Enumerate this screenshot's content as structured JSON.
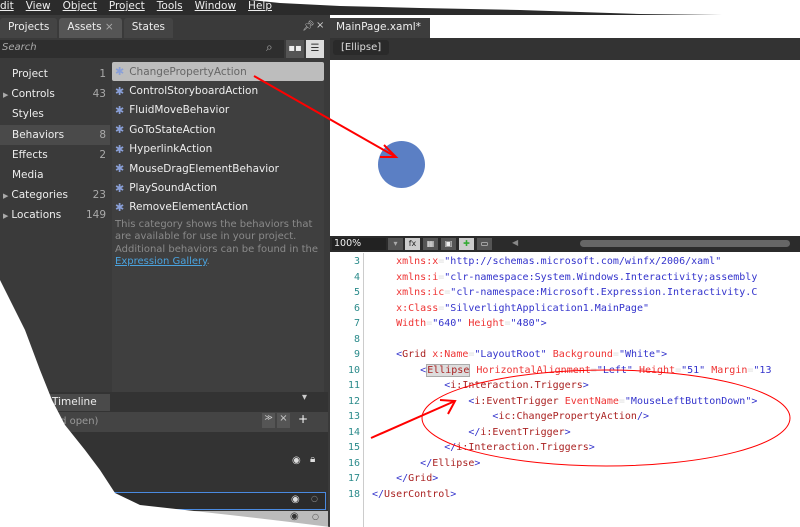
{
  "menu": [
    "dit",
    "View",
    "Object",
    "Project",
    "Tools",
    "Window",
    "Help"
  ],
  "left_tabs": [
    "Projects",
    "Assets",
    "States"
  ],
  "search_placeholder": "Search",
  "categories": [
    {
      "label": "Project",
      "count": "1"
    },
    {
      "label": "Controls",
      "count": "43",
      "expand": true
    },
    {
      "label": "Styles",
      "count": ""
    },
    {
      "label": "Behaviors",
      "count": "8",
      "selected": true
    },
    {
      "label": "Effects",
      "count": "2"
    },
    {
      "label": "Media",
      "count": ""
    },
    {
      "label": "Categories",
      "count": "23",
      "expand": true
    },
    {
      "label": "Locations",
      "count": "149",
      "expand": true
    }
  ],
  "assets": [
    "ChangePropertyAction",
    "ControlStoryboardAction",
    "FluidMoveBehavior",
    "GoToStateAction",
    "HyperlinkAction",
    "MouseDragElementBehavior",
    "PlaySoundAction",
    "RemoveElementAction"
  ],
  "description": "This category shows the behaviors that are available for use in your project. Additional behaviors can be found in the ",
  "description_link": "Expression Gallery",
  "timeline": {
    "title": "d Timeline",
    "storyboard": "ard open)"
  },
  "document": {
    "tab": "MainPage.xaml*",
    "breadcrumb": "[Ellipse]",
    "zoom": "100%"
  },
  "colors": {
    "ellipse": "#5b7fc4",
    "annotation": "#ff0000"
  },
  "code_lines": [
    {
      "n": "3",
      "html": "    <span class='r'>xmlns:x</span>=<span class='b'>\"http://schemas.microsoft.com/winfx/2006/xaml\"</span>"
    },
    {
      "n": "4",
      "html": "    <span class='r'>xmlns:i</span>=<span class='b'>\"clr-namespace:System.Windows.Interactivity;assembly</span>"
    },
    {
      "n": "5",
      "html": "    <span class='r'>xmlns:ic</span>=<span class='b'>\"clr-namespace:Microsoft.Expression.Interactivity.C</span>"
    },
    {
      "n": "6",
      "html": "    <span class='r'>x:Class</span>=<span class='b'>\"SilverlightApplication1.MainPage\"</span>"
    },
    {
      "n": "7",
      "html": "    <span class='r'>Width</span>=<span class='b'>\"640\"</span> <span class='r'>Height</span>=<span class='b'>\"480\"</span><span class='k'>&gt;</span>"
    },
    {
      "n": "8",
      "html": ""
    },
    {
      "n": "9",
      "html": "    <span class='k'>&lt;</span><span class='m'>Grid</span> <span class='r'>x:Name</span>=<span class='b'>\"LayoutRoot\"</span> <span class='r'>Background</span>=<span class='b'>\"White\"</span><span class='k'>&gt;</span>"
    },
    {
      "n": "10",
      "html": "        <span class='k'>&lt;</span><span class='m hl'>Ellipse</span> <span class='r'>HorizontalAlignment</span>=<span class='b'>\"Left\"</span> <span class='r'>Height</span>=<span class='b'>\"51\"</span> <span class='r'>Margin</span>=<span class='b'>\"13</span>"
    },
    {
      "n": "11",
      "html": "            <span class='k'>&lt;</span><span class='m'>i:Interaction.Triggers</span><span class='k'>&gt;</span>"
    },
    {
      "n": "12",
      "html": "                <span class='k'>&lt;</span><span class='m'>i:EventTrigger</span> <span class='r'>EventName</span>=<span class='b'>\"MouseLeftButtonDown\"</span><span class='k'>&gt;</span>"
    },
    {
      "n": "13",
      "html": "                    <span class='k'>&lt;</span><span class='m'>ic:ChangePropertyAction</span><span class='k'>/&gt;</span>"
    },
    {
      "n": "14",
      "html": "                <span class='k'>&lt;/</span><span class='m'>i:EventTrigger</span><span class='k'>&gt;</span>"
    },
    {
      "n": "15",
      "html": "            <span class='k'>&lt;/</span><span class='m'>i:Interaction.Triggers</span><span class='k'>&gt;</span>"
    },
    {
      "n": "16",
      "html": "        <span class='k'>&lt;/</span><span class='m'>Ellipse</span><span class='k'>&gt;</span>"
    },
    {
      "n": "17",
      "html": "    <span class='k'>&lt;/</span><span class='m'>Grid</span><span class='k'>&gt;</span>"
    },
    {
      "n": "18",
      "html": "<span class='k'>&lt;/</span><span class='m'>UserControl</span><span class='k'>&gt;</span>"
    }
  ]
}
